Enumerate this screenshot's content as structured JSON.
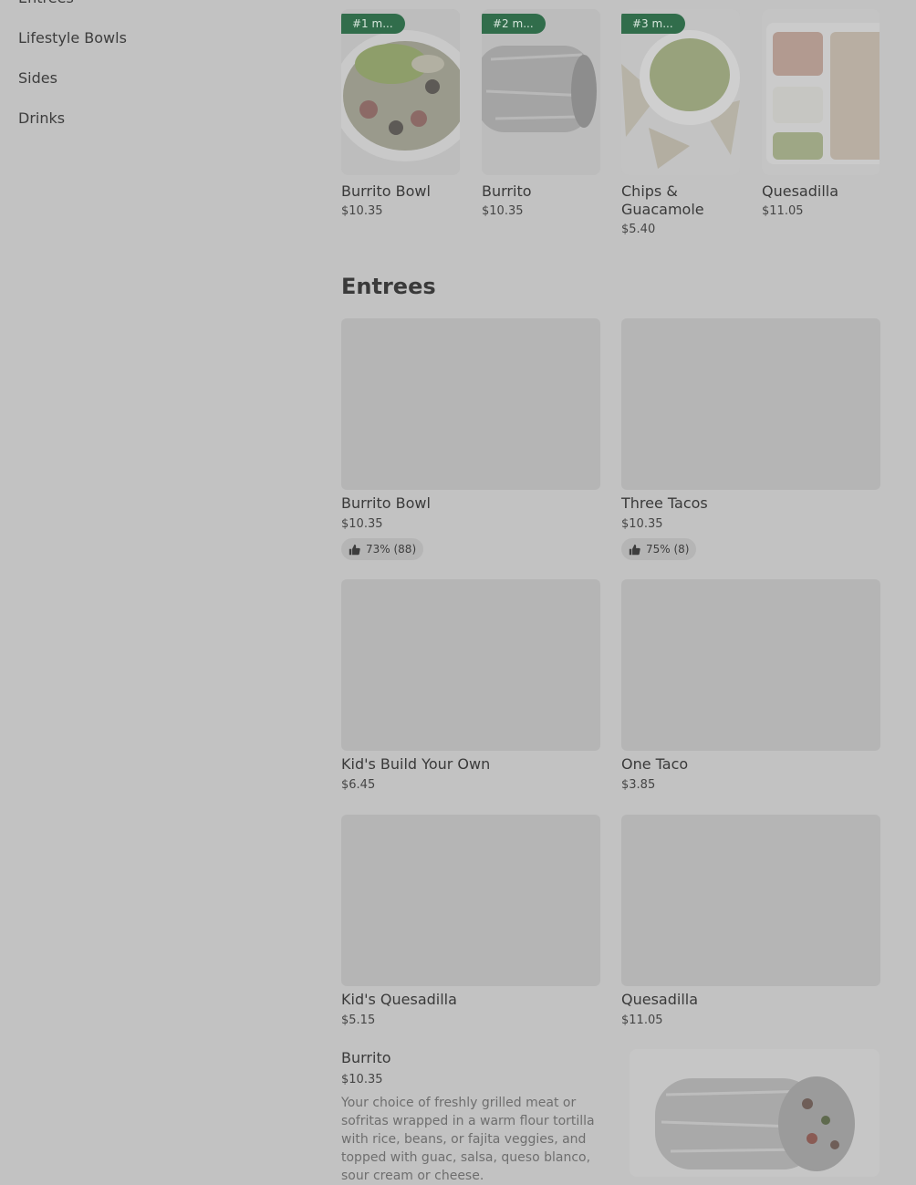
{
  "sidebar": {
    "items": [
      {
        "label": "Entrees"
      },
      {
        "label": "Lifestyle Bowls"
      },
      {
        "label": "Sides"
      },
      {
        "label": "Drinks"
      }
    ]
  },
  "popular": [
    {
      "badge": "#1 m...",
      "name": "Burrito Bowl",
      "price": "$10.35"
    },
    {
      "badge": "#2 m...",
      "name": "Burrito",
      "price": "$10.35"
    },
    {
      "badge": "#3 m...",
      "name": "Chips & Guacamole",
      "price": "$5.40"
    },
    {
      "badge": "",
      "name": "Quesadilla",
      "price": "$11.05"
    }
  ],
  "entrees": {
    "title": "Entrees",
    "items": [
      {
        "name": "Burrito Bowl",
        "price": "$10.35",
        "rating": "73% (88)"
      },
      {
        "name": "Three Tacos",
        "price": "$10.35",
        "rating": "75% (8)"
      },
      {
        "name": "Kid's Build Your Own",
        "price": "$6.45"
      },
      {
        "name": "One Taco",
        "price": "$3.85"
      },
      {
        "name": "Kid's Quesadilla",
        "price": "$5.15"
      },
      {
        "name": "Quesadilla",
        "price": "$11.05"
      }
    ],
    "featured": {
      "name": "Burrito",
      "price": "$10.35",
      "description": "Your choice of freshly grilled meat or sofritas wrapped in a warm flour tortilla with rice, beans, or fajita veggies, and topped with guac, salsa, queso blanco, sour cream or cheese."
    }
  },
  "colors": {
    "badge": "#316d4b",
    "background": "#c2c2c2"
  }
}
